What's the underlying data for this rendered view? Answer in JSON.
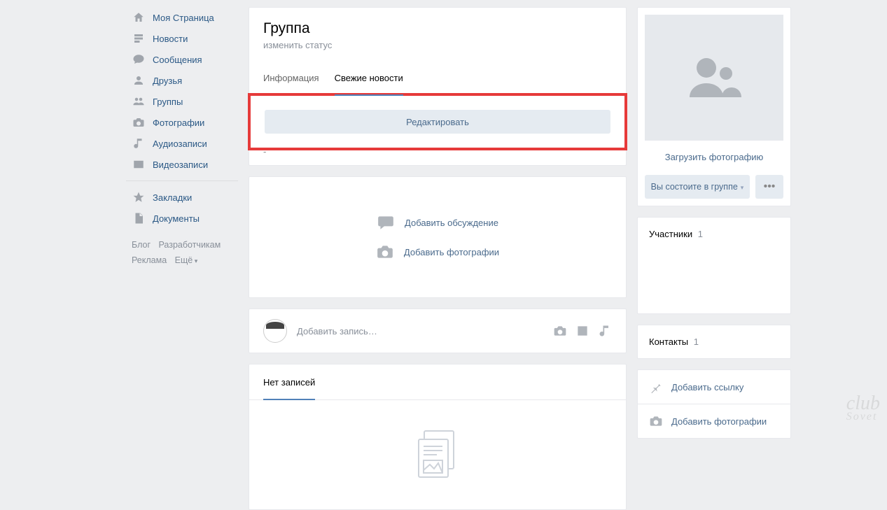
{
  "nav": {
    "items": [
      {
        "label": "Моя Страница"
      },
      {
        "label": "Новости"
      },
      {
        "label": "Сообщения"
      },
      {
        "label": "Друзья"
      },
      {
        "label": "Группы"
      },
      {
        "label": "Фотографии"
      },
      {
        "label": "Аудиозаписи"
      },
      {
        "label": "Видеозаписи"
      }
    ],
    "bookmarks": "Закладки",
    "documents": "Документы"
  },
  "footer": {
    "blog": "Блог",
    "developers": "Разработчикам",
    "ads": "Реклама",
    "more": "Ещё"
  },
  "group": {
    "title": "Группа",
    "change_status": "изменить статус",
    "tabs": {
      "info": "Информация",
      "news": "Свежие новости"
    },
    "edit_button": "Редактировать"
  },
  "add": {
    "discussion": "Добавить обсуждение",
    "photos": "Добавить фотографии"
  },
  "post_input": {
    "placeholder": "Добавить запись…"
  },
  "no_posts": {
    "label": "Нет записей"
  },
  "right": {
    "upload_photo": "Загрузить фотографию",
    "membership": "Вы состоите в группе",
    "members": {
      "title": "Участники",
      "count": "1"
    },
    "contacts": {
      "title": "Контакты",
      "count": "1"
    },
    "add_link": "Добавить ссылку",
    "add_photos": "Добавить фотографии"
  },
  "watermark": {
    "line1": "club",
    "line2": "Sovet"
  }
}
